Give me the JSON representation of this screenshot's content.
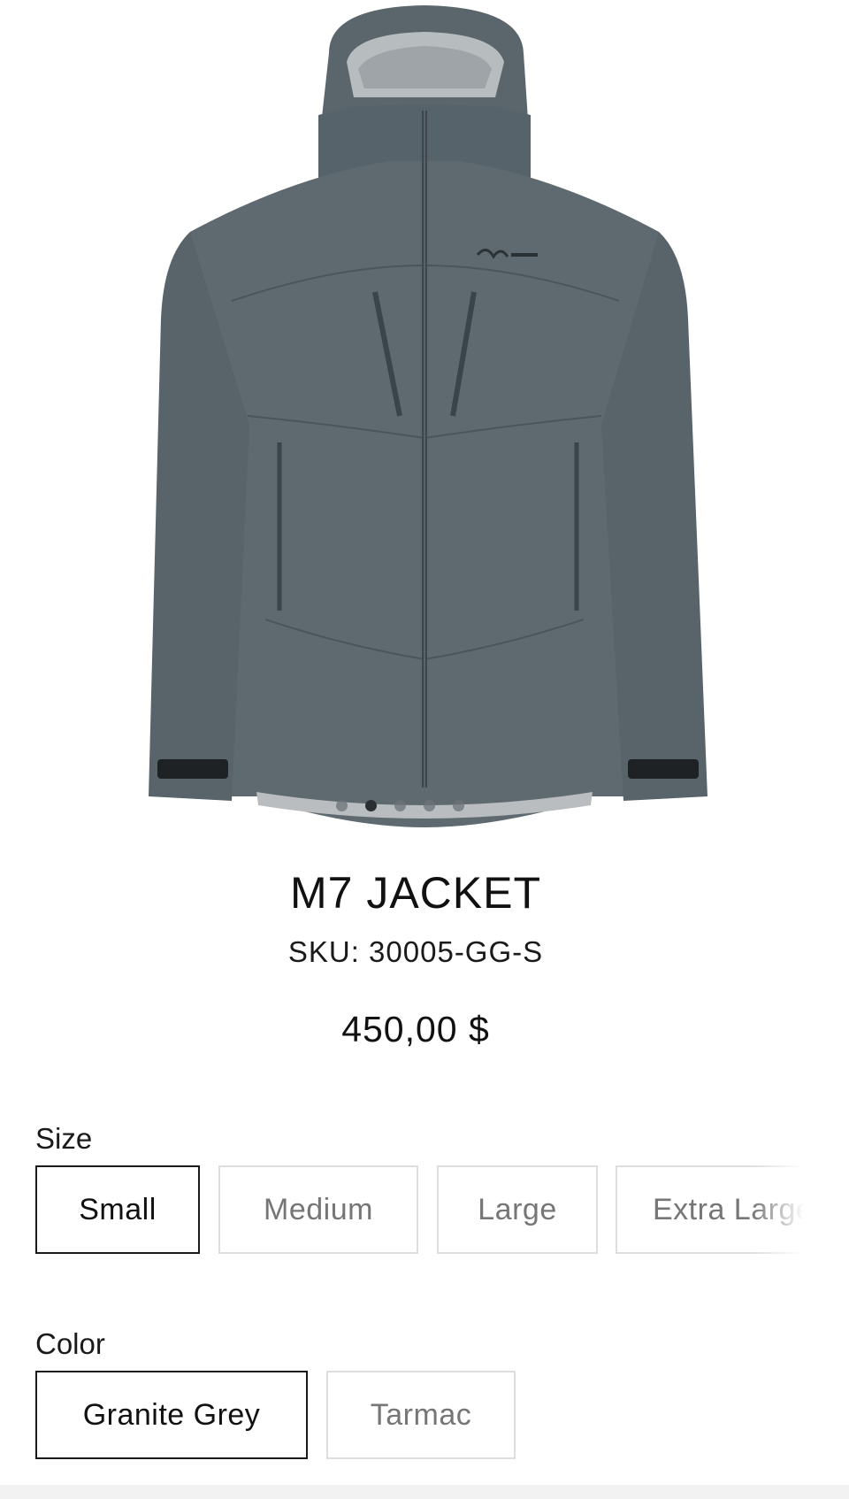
{
  "product": {
    "title": "M7 JACKET",
    "sku": "SKU: 30005-GG-S",
    "price": "450,00 $",
    "image_icon": "jacket-image",
    "carousel": {
      "count": 5,
      "active_index": 1
    }
  },
  "size": {
    "label": "Size",
    "options": [
      "Small",
      "Medium",
      "Large",
      "Extra Large"
    ],
    "selected": "Small"
  },
  "color": {
    "label": "Color",
    "options": [
      "Granite Grey",
      "Tarmac"
    ],
    "selected": "Granite Grey"
  },
  "colors": {
    "jacket": "#5f6a70",
    "jacket_dark": "#4c565c",
    "jacket_shadow": "#455056",
    "selected_border": "#1a1a1a",
    "unselected_border": "#dedede"
  }
}
